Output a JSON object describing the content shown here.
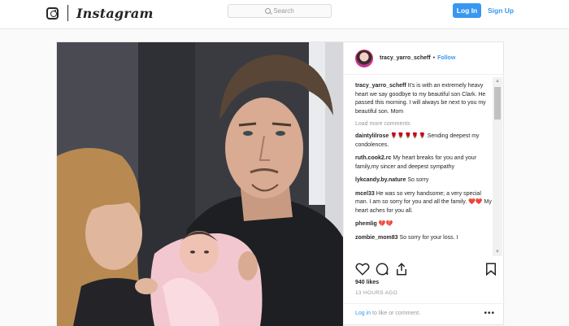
{
  "nav": {
    "brand": "Instagram",
    "search_placeholder": "Search",
    "login_label": "Log In",
    "signup_label": "Sign Up"
  },
  "post": {
    "username": "tracy_yarro_scheff",
    "follow_label": "Follow",
    "dot": "•",
    "caption_user": "tracy_yarro_scheff",
    "caption_text": "It's is with an extremely heavy heart we say goodbye to my beautiful son Clark. He passed this morning. I will always be next to you my beautiful son. Mom",
    "load_more": "Load more comments",
    "comments": [
      {
        "user": "daintylilrose",
        "text": "Sending deepest my condolences.",
        "hearts": "🌹🌹🌹🌹🌹"
      },
      {
        "user": "ruth.cook2.rc",
        "text": "My heart breaks for you and your family,my sincer and deepest sympathy",
        "hearts": ""
      },
      {
        "user": "lykcandy.by.nature",
        "text": "So sorry",
        "hearts": ""
      },
      {
        "user": "mcel33",
        "text": "He was so very handsome; a very special man. I am so sorry for you and all the family. ❤️❤️ My heart aches for you all.",
        "hearts": ""
      },
      {
        "user": "phemlig",
        "text": "",
        "hearts": "💔💔"
      },
      {
        "user": "zombie_mom83",
        "text": "So sorry for your loss. I",
        "hearts": ""
      }
    ],
    "likes": "940 likes",
    "time": "13 HOURS AGO",
    "footer_login": "Log in",
    "footer_text": "to like or comment.",
    "more_label": "•••"
  },
  "colors": {
    "accent": "#3897f0",
    "text": "#262626",
    "muted": "#999999",
    "border": "#e6e6e6"
  },
  "icons": [
    "instagram-glyph-icon",
    "search-icon",
    "heart-icon",
    "comment-icon",
    "share-icon",
    "bookmark-icon",
    "more-icon"
  ]
}
